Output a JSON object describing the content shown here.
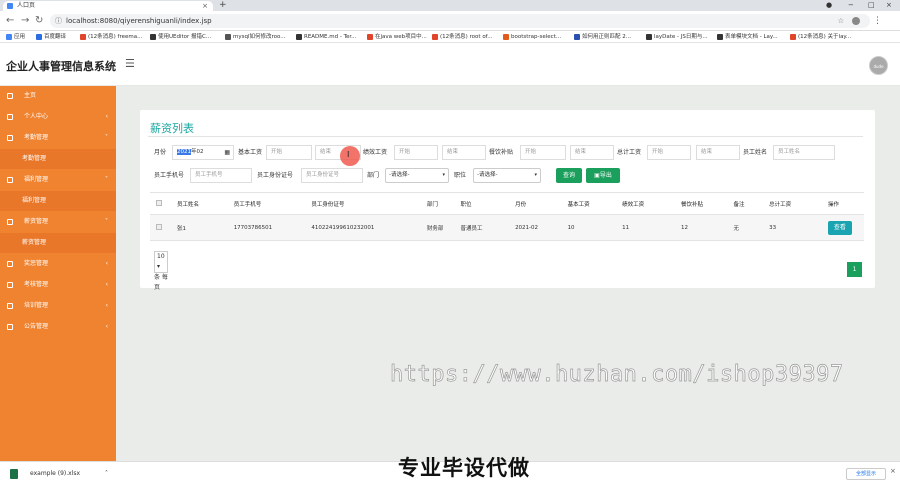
{
  "browser": {
    "tab_title": "人口页",
    "url": "localhost:8080/qiyerenshiguanli/index.jsp",
    "bookmarks": [
      "应用",
      "百度翻译",
      "(12条消息) freema...",
      "使用UEditor 报错C...",
      "mysql如何修改roo...",
      "README.md - Ter...",
      "在java web项目中...",
      "(12条消息) root of...",
      "bootstrap-select...",
      "如何用正则匹配 2...",
      "layDate - JS日期与...",
      "表单模块文档 - Lay...",
      "(12条消息) 关于lay..."
    ]
  },
  "app": {
    "title": "企业人事管理信息系统",
    "avatar_text": "dude"
  },
  "sidebar": {
    "items": [
      {
        "label": "主页"
      },
      {
        "label": "个人中心"
      },
      {
        "label": "考勤管理"
      },
      {
        "label": "考勤管理"
      },
      {
        "label": "福利管理"
      },
      {
        "label": "福利管理"
      },
      {
        "label": "薪资管理"
      },
      {
        "label": "薪资管理"
      },
      {
        "label": "奖惩管理"
      },
      {
        "label": "考核管理"
      },
      {
        "label": "培训管理"
      },
      {
        "label": "公告管理"
      }
    ]
  },
  "page": {
    "title": "薪资列表",
    "filters": {
      "month_label": "月份",
      "month_value_year": "2021",
      "month_value_rest": "年02",
      "base_salary_label": "基本工资",
      "performance_label": "绩效工资",
      "meal_label": "餐饮补贴",
      "total_label": "总计工资",
      "employee_name_label": "员工姓名",
      "employee_name_placeholder": "员工姓名",
      "phone_label": "员工手机号",
      "phone_placeholder": "员工手机号",
      "idcard_label": "员工身份证号",
      "idcard_placeholder": "员工身份证号",
      "dept_label": "部门",
      "dept_value": "-请选择-",
      "position_label": "职位",
      "position_value": "-请选择-",
      "start_placeholder": "开始",
      "end_placeholder": "结束"
    },
    "buttons": {
      "search": "查询",
      "export": "导出"
    },
    "table": {
      "headers": [
        "员工姓名",
        "员工手机号",
        "员工身份证号",
        "部门",
        "职位",
        "月份",
        "基本工资",
        "绩效工资",
        "餐饮补贴",
        "备注",
        "总计工资",
        "操作"
      ],
      "rows": [
        [
          "张1",
          "17703786501",
          "410224199610232001",
          "财务部",
          "普通员工",
          "2021-02",
          "10",
          "11",
          "12",
          "无",
          "33"
        ]
      ],
      "view_button": "查看"
    },
    "pagination": {
      "page_size": "10",
      "page_size_suffix": "条 每页",
      "current_page": "1"
    }
  },
  "overlay": {
    "watermark_url": "https://www.huzhan.com/ishop39397",
    "watermark_text": "专业毕设代做"
  },
  "download": {
    "filename": "example (9).xlsx",
    "show_all": "全部显示"
  }
}
